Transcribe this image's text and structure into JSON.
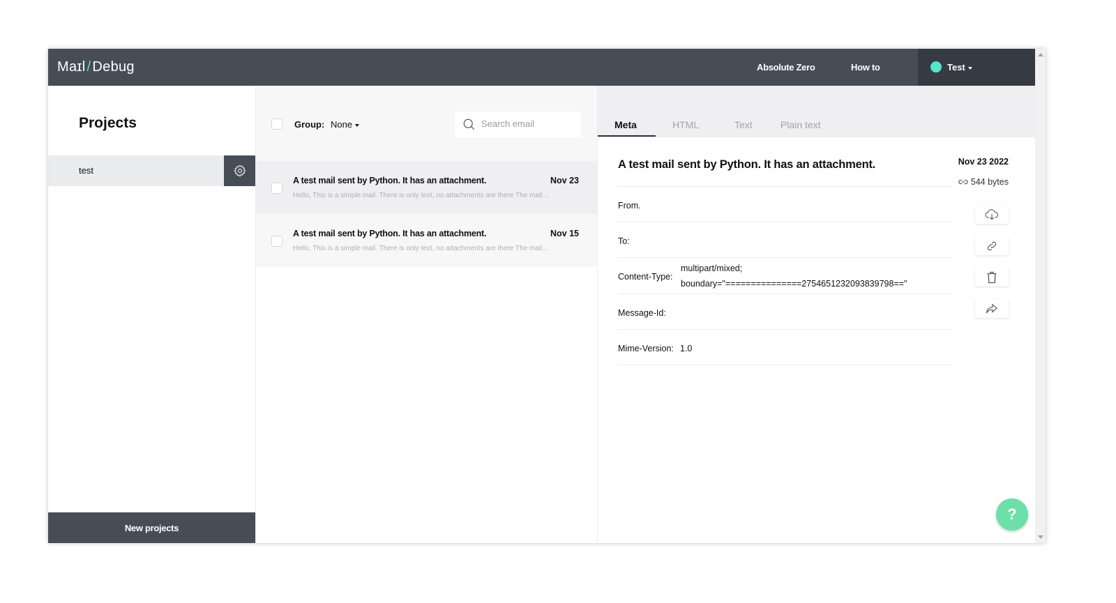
{
  "header": {
    "logo_left": "Maɪl",
    "logo_slash": "/",
    "logo_right": "Debug",
    "nav": [
      {
        "label": "Absolute Zero"
      },
      {
        "label": "How to"
      }
    ],
    "user": {
      "name": "Test",
      "status_color": "#55e6cc"
    }
  },
  "sidebar": {
    "title": "Projects",
    "projects": [
      {
        "name": "test",
        "selected": true
      }
    ],
    "new_projects_label": "New projects"
  },
  "maillist": {
    "group_label": "Group:",
    "group_value": "None",
    "search_placeholder": "Search email",
    "search_value": "",
    "items": [
      {
        "subject": "A test mail sent by Python. It has an attachment.",
        "date": "Nov 23",
        "preview": "Hello, This is a simple mail. There is only text, no attachments are there The mail…",
        "selected": true
      },
      {
        "subject": "A test mail sent by Python. It has an attachment.",
        "date": "Nov 15",
        "preview": "Hello, This is a simple mail. There is only text, no attachments are there The mail…",
        "selected": false
      }
    ]
  },
  "detail": {
    "tabs": [
      {
        "label": "Meta",
        "active": true
      },
      {
        "label": "HTML",
        "active": false
      },
      {
        "label": "Text",
        "active": false
      },
      {
        "label": "Plain text",
        "active": false
      }
    ],
    "subject": "A test mail sent by Python. It has an attachment.",
    "date": "Nov 23 2022",
    "size": "544 bytes",
    "meta": [
      {
        "label": "From.",
        "value": ""
      },
      {
        "label": "To:",
        "value": ""
      },
      {
        "label": "Content-Type:",
        "value_line1": "multipart/mixed;",
        "value_line2": "boundary=\"===============2754651232093839798==\""
      },
      {
        "label": "Message-Id:",
        "value": ""
      },
      {
        "label": "Mime-Version:",
        "value": "1.0"
      }
    ],
    "actions": [
      {
        "name": "download",
        "icon": "cloud-download-icon"
      },
      {
        "name": "copy-link",
        "icon": "link-icon"
      },
      {
        "name": "delete",
        "icon": "trash-icon"
      },
      {
        "name": "forward",
        "icon": "share-icon"
      }
    ]
  },
  "help_label": "?",
  "colors": {
    "topbar": "#474d57",
    "accent": "#55e6cc",
    "help": "#6ddfa8"
  }
}
